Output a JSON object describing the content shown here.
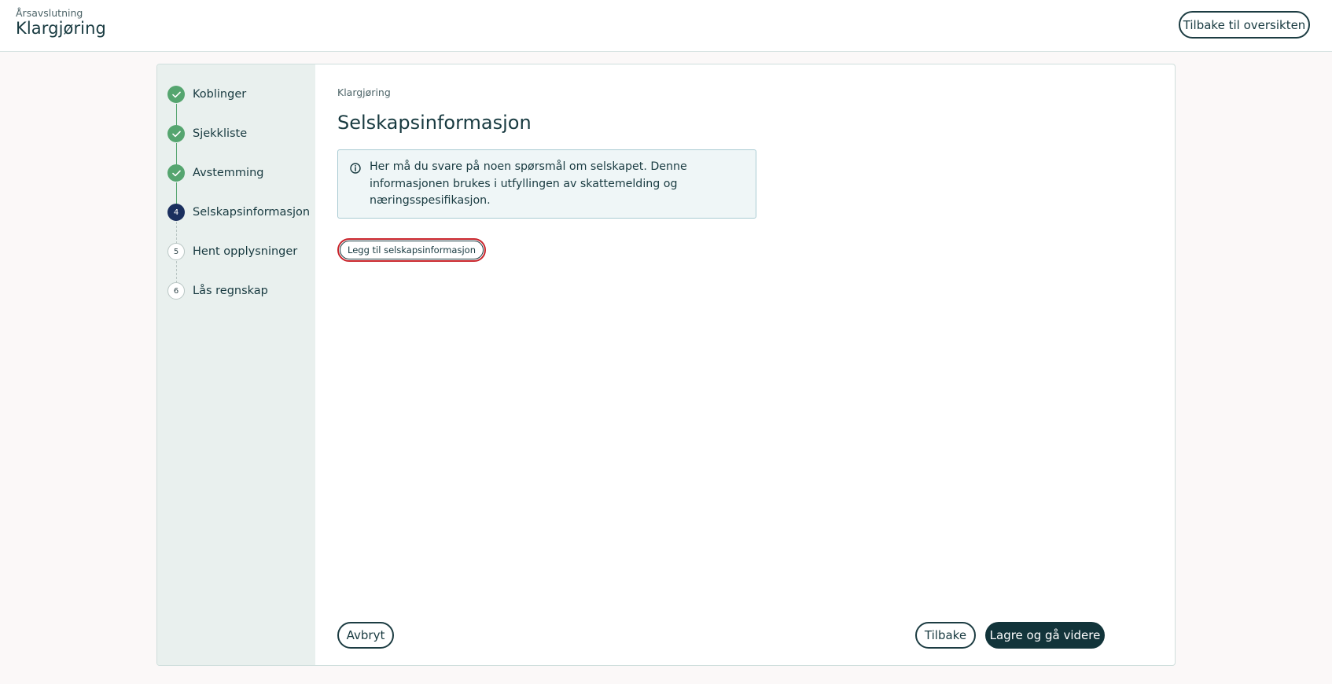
{
  "header": {
    "eyebrow": "Årsavslutning",
    "title": "Klargjøring",
    "back_to_overview_label": "Tilbake til oversikten"
  },
  "steps": [
    {
      "number": "1",
      "label": "Koblinger",
      "status": "done"
    },
    {
      "number": "2",
      "label": "Sjekkliste",
      "status": "done"
    },
    {
      "number": "3",
      "label": "Avstemming",
      "status": "done"
    },
    {
      "number": "4",
      "label": "Selskapsinformasjon",
      "status": "active"
    },
    {
      "number": "5",
      "label": "Hent opplysninger",
      "status": "todo"
    },
    {
      "number": "6",
      "label": "Lås regnskap",
      "status": "todo"
    }
  ],
  "main": {
    "breadcrumb": "Klargjøring",
    "title": "Selskapsinformasjon",
    "info_text": "Her må du svare på noen spørsmål om selskapet. Denne informasjonen brukes i utfyllingen av skattemelding og næringsspesifikasjon.",
    "add_button_label": "Legg til selskapsinformasjon"
  },
  "footer": {
    "cancel_label": "Avbryt",
    "back_label": "Tilbake",
    "save_continue_label": "Lagre og gå videre"
  },
  "icons": {
    "done": "check-icon",
    "info": "info-icon"
  },
  "colors": {
    "done": "#55a56f",
    "active": "#1a2f5e",
    "primary": "#12343a",
    "highlight": "#c9252c"
  }
}
